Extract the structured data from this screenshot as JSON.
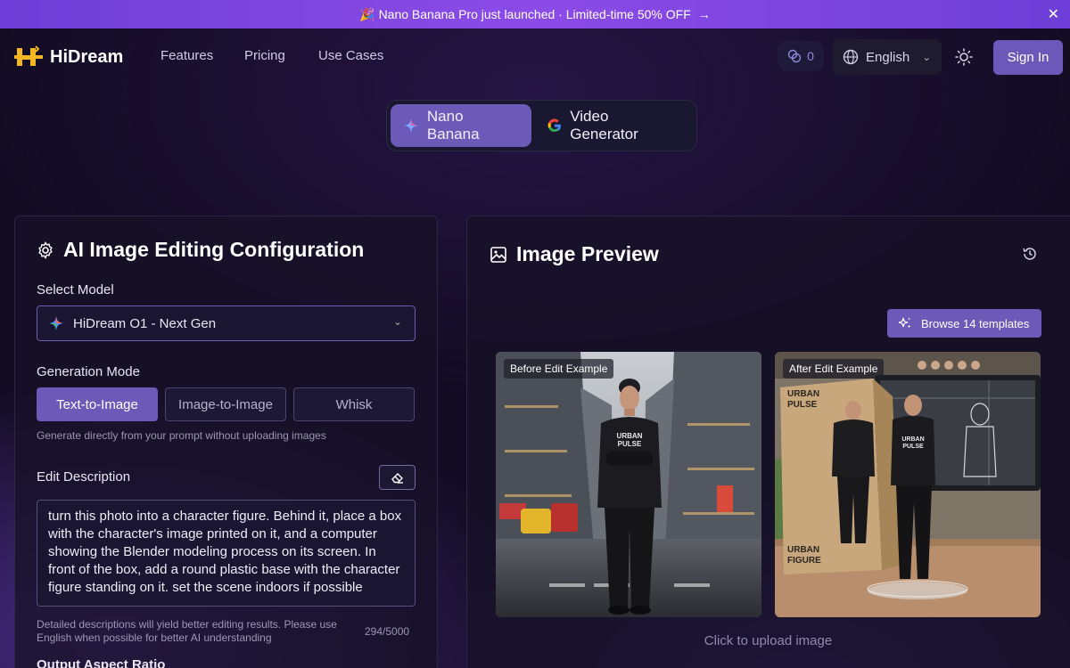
{
  "banner": {
    "text": "🎉 Nano Banana Pro just launched · Limited-time 50% OFF",
    "arrow": "→",
    "close": "✕"
  },
  "nav": {
    "brand": "HiDream",
    "links": [
      "Features",
      "Pricing",
      "Use Cases"
    ],
    "credits": "0",
    "language": "English",
    "sign_in": "Sign In"
  },
  "switch": {
    "tabs": [
      {
        "label": "Nano Banana",
        "active": true
      },
      {
        "label": "Video Generator",
        "active": false
      }
    ]
  },
  "config": {
    "title": "AI Image Editing Configuration",
    "model_label": "Select Model",
    "model_value": "HiDream O1 - Next Gen",
    "mode_label": "Generation Mode",
    "modes": [
      {
        "label": "Text-to-Image",
        "active": true
      },
      {
        "label": "Image-to-Image",
        "active": false
      },
      {
        "label": "Whisk",
        "active": false
      }
    ],
    "mode_hint": "Generate directly from your prompt without uploading images",
    "edit_label": "Edit Description",
    "edit_text": "turn this photo into a character figure. Behind it, place a box with the character's image printed on it, and a computer showing the Blender modeling process on its screen. In front of the box, add a round plastic base with the character figure standing on it. set the scene indoors if possible",
    "edit_hint": "Detailed descriptions will yield better editing results. Please use English when possible for better AI understanding",
    "counter": "294/5000",
    "aspect_label": "Output Aspect Ratio"
  },
  "preview": {
    "title": "Image Preview",
    "browse": "Browse 14 templates",
    "before_tag": "Before Edit Example",
    "after_tag": "After Edit Example",
    "upload_hint": "Click to upload image"
  },
  "colors": {
    "accent": "#6c5ab8",
    "banner": "#8c4be6",
    "background": "#120c22"
  }
}
